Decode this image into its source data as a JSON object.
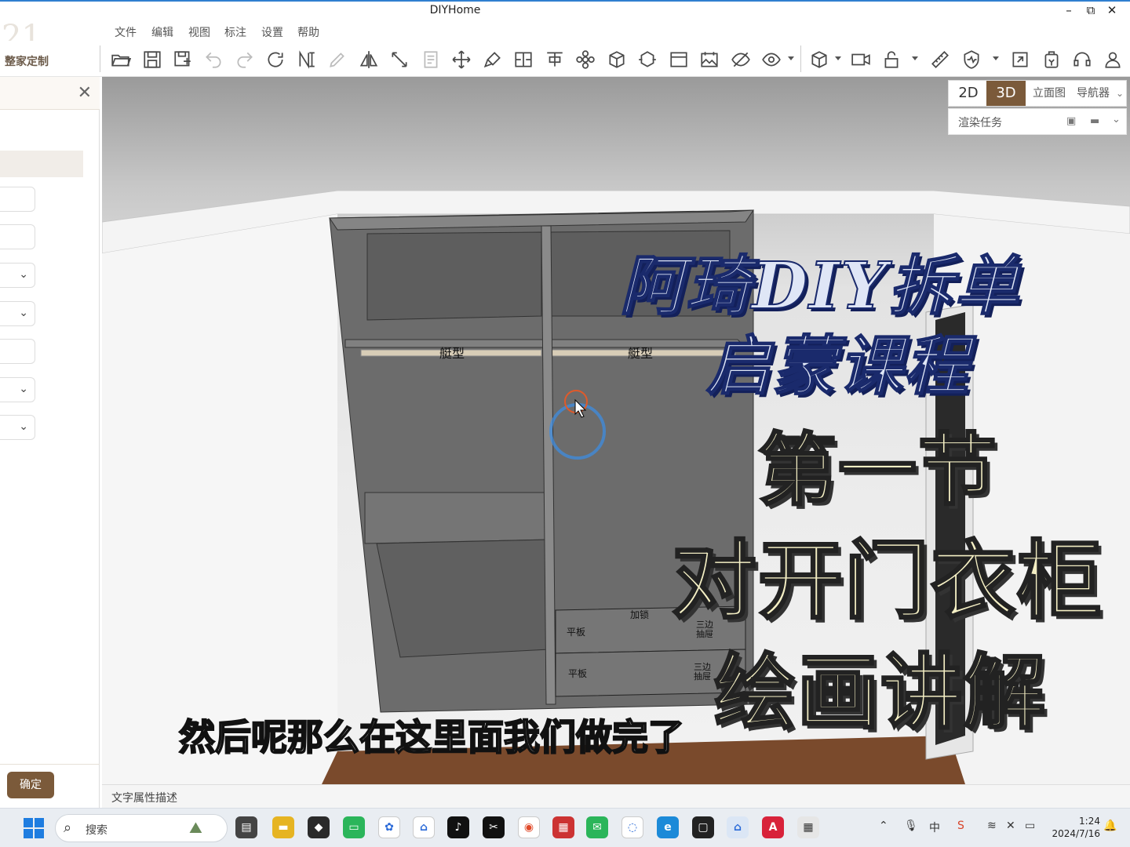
{
  "window": {
    "title": "DIYHome",
    "minimize": "–",
    "restore": "⧉",
    "close": "✕"
  },
  "menu": [
    "文件",
    "编辑",
    "视图",
    "标注",
    "设置",
    "帮助"
  ],
  "toolbar": {
    "brand_label": "整家定制",
    "icons": [
      "open-folder",
      "save",
      "save-as",
      "undo",
      "redo",
      "refresh",
      "dimension",
      "pencil",
      "mirror",
      "measure",
      "report",
      "move",
      "brush",
      "split",
      "align",
      "gear-flower",
      "cube-rotate",
      "cube-ops",
      "window",
      "image",
      "hide-eye",
      "eye",
      "box-view",
      "camera",
      "lock",
      "ruler",
      "shield",
      "export",
      "purse",
      "headset",
      "user"
    ]
  },
  "left_panel": {
    "confirm_label": "确定"
  },
  "view_tabs": {
    "tab_2d": "2D",
    "tab_3d": "3D",
    "elevation": "立面图",
    "navigator": "导航器",
    "render_tasks": "渲染任务"
  },
  "scene_labels": {
    "rod_left": "艇型",
    "rod_right": "艇型",
    "lock": "加锁",
    "drawer1_left": "平板",
    "drawer1_right_1": "三边",
    "drawer1_right_2": "抽屉",
    "drawer2_left": "平板",
    "drawer2_right_1": "三边",
    "drawer2_right_2": "抽屉"
  },
  "overlay": {
    "line1": "阿琦DIY拆单",
    "line2": "启蒙课程",
    "line3": "第一节",
    "line4": "对开门衣柜",
    "line5": "绘画讲解"
  },
  "subtitle": "然后呢那么在这里面我们做完了",
  "status": {
    "text": "文字属性描述"
  },
  "taskbar": {
    "search_placeholder": "搜索",
    "ime": "中",
    "time": "1:24",
    "date": "2024/7/16"
  },
  "colors": {
    "accent_brown": "#7b5a3a",
    "cabinet_gray": "#6e6e6e",
    "floor_wood": "#7a4a2c",
    "title_blue": "#1a2a6c"
  }
}
